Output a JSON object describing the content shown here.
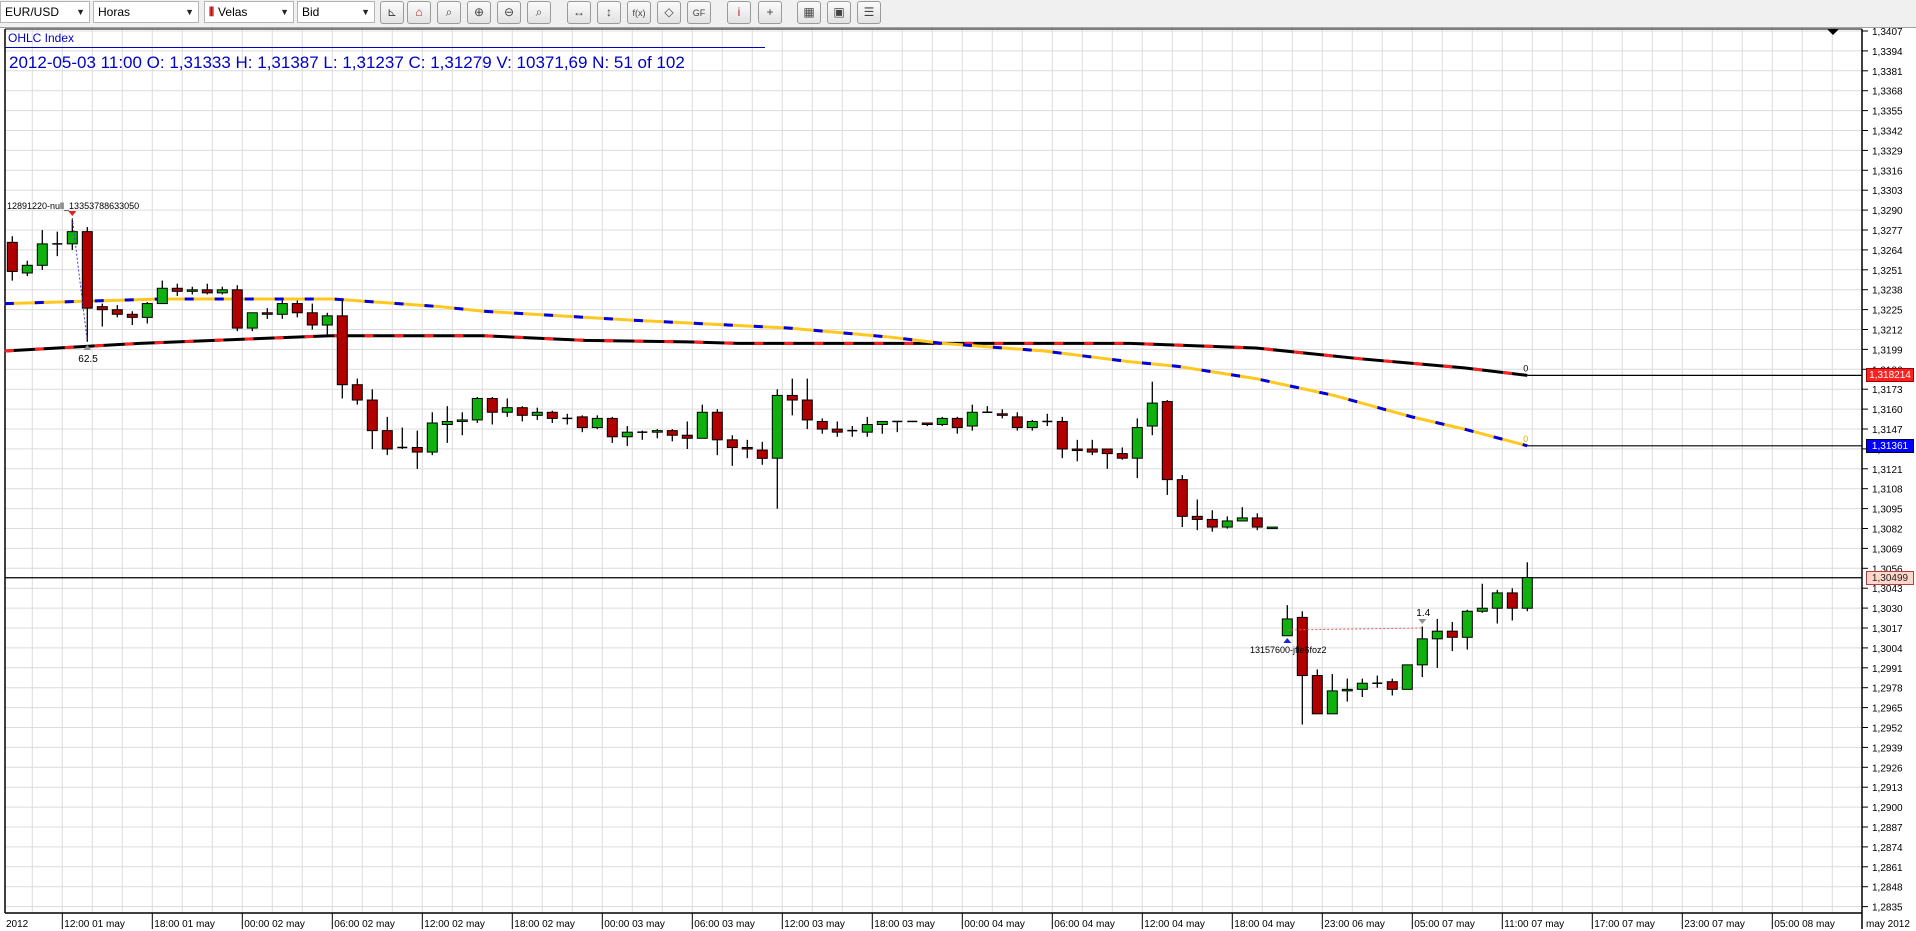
{
  "toolbar": {
    "combos": [
      {
        "value": "EUR/USD"
      },
      {
        "value": "Horas"
      },
      {
        "value": "Velas",
        "icon": "candlestick-icon",
        "glyph": "⫴"
      },
      {
        "value": "Bid"
      }
    ],
    "combo_arrow": "▼",
    "buttons": [
      {
        "icon": "axis-marker-icon",
        "glyph": "⊾"
      },
      {
        "icon": "lock-icon",
        "glyph": "⌂"
      },
      {
        "icon": "zoom-fit-icon",
        "glyph": "⌕"
      },
      {
        "icon": "zoom-in-icon",
        "glyph": "⊕"
      },
      {
        "icon": "zoom-out-icon",
        "glyph": "⊖"
      },
      {
        "icon": "zoom-select-icon",
        "glyph": "⌕"
      },
      {
        "icon": "fit-horizontal-icon",
        "glyph": "↔"
      },
      {
        "icon": "fit-vertical-icon",
        "glyph": "↕"
      },
      {
        "icon": "function-icon",
        "glyph": "f(x)"
      },
      {
        "icon": "shapes-icon",
        "glyph": "◇"
      },
      {
        "icon": "gf-icon",
        "glyph": "GF"
      },
      {
        "icon": "info-icon",
        "glyph": "i"
      },
      {
        "icon": "crosshair-icon",
        "glyph": "+"
      },
      {
        "icon": "color-palette-icon",
        "glyph": "▦"
      },
      {
        "icon": "save-image-icon",
        "glyph": "▣"
      },
      {
        "icon": "window-layout-icon",
        "glyph": "☰"
      }
    ]
  },
  "header": {
    "title": "OHLC Index",
    "ohlc_readout": "2012-05-03 11:00 O: 1,31333 H: 1,31387 L: 1,31237 C: 1,31279 V: 10371,69 N: 51 of 102"
  },
  "chart_data": {
    "type": "candlestick",
    "symbol": "EUR/USD",
    "timeframe": "Horas",
    "price_type": "Bid",
    "bar_count": 102,
    "ylim": [
      1.2835,
      1.3407
    ],
    "grid": true,
    "colors": {
      "up": "#10b010",
      "down": "#b00000",
      "ma_slow": [
        "#000000",
        "#ff2020"
      ],
      "ma_fast": [
        "#ffc820",
        "#0000e0"
      ]
    },
    "candles_ohlc": [
      [
        1.3269,
        1.3273,
        1.3244,
        1.325
      ],
      [
        1.3249,
        1.3257,
        1.3247,
        1.3254
      ],
      [
        1.3254,
        1.3277,
        1.3251,
        1.3268
      ],
      [
        1.3268,
        1.3276,
        1.326,
        1.3268
      ],
      [
        1.3268,
        1.3284,
        1.3264,
        1.3276
      ],
      [
        1.3276,
        1.3279,
        1.3204,
        1.3226
      ],
      [
        1.3227,
        1.3229,
        1.3214,
        1.3225
      ],
      [
        1.3225,
        1.3228,
        1.322,
        1.3222
      ],
      [
        1.3222,
        1.3224,
        1.3215,
        1.322
      ],
      [
        1.322,
        1.323,
        1.3216,
        1.3229
      ],
      [
        1.3229,
        1.3244,
        1.3229,
        1.3239
      ],
      [
        1.3239,
        1.3242,
        1.3234,
        1.3237
      ],
      [
        1.3237,
        1.324,
        1.3235,
        1.3238
      ],
      [
        1.3238,
        1.3242,
        1.3235,
        1.3236
      ],
      [
        1.3236,
        1.324,
        1.3235,
        1.3238
      ],
      [
        1.3238,
        1.3241,
        1.3211,
        1.3213
      ],
      [
        1.3213,
        1.3223,
        1.3211,
        1.3223
      ],
      [
        1.3223,
        1.3226,
        1.3219,
        1.3222
      ],
      [
        1.3222,
        1.3231,
        1.3219,
        1.3229
      ],
      [
        1.3229,
        1.3231,
        1.322,
        1.3223
      ],
      [
        1.3223,
        1.3229,
        1.3212,
        1.3215
      ],
      [
        1.3215,
        1.3223,
        1.3207,
        1.3221
      ],
      [
        1.3221,
        1.3231,
        1.3167,
        1.3176
      ],
      [
        1.3176,
        1.318,
        1.3163,
        1.3166
      ],
      [
        1.3166,
        1.3173,
        1.3134,
        1.3146
      ],
      [
        1.3146,
        1.3155,
        1.313,
        1.3134
      ],
      [
        1.3135,
        1.3148,
        1.3134,
        1.3135
      ],
      [
        1.3135,
        1.3146,
        1.3121,
        1.3132
      ],
      [
        1.3132,
        1.3158,
        1.313,
        1.3151
      ],
      [
        1.315,
        1.3162,
        1.3138,
        1.3152
      ],
      [
        1.3152,
        1.3158,
        1.3143,
        1.3153
      ],
      [
        1.3153,
        1.3168,
        1.3151,
        1.3167
      ],
      [
        1.3167,
        1.3168,
        1.315,
        1.3158
      ],
      [
        1.3158,
        1.3167,
        1.3155,
        1.3161
      ],
      [
        1.3161,
        1.3162,
        1.3152,
        1.3156
      ],
      [
        1.3156,
        1.3161,
        1.3153,
        1.3158
      ],
      [
        1.3158,
        1.3159,
        1.3151,
        1.3154
      ],
      [
        1.3154,
        1.3157,
        1.315,
        1.3154
      ],
      [
        1.3155,
        1.3156,
        1.3145,
        1.3148
      ],
      [
        1.3148,
        1.3156,
        1.3147,
        1.3154
      ],
      [
        1.3154,
        1.3155,
        1.3138,
        1.3142
      ],
      [
        1.3142,
        1.3149,
        1.3136,
        1.3145
      ],
      [
        1.3145,
        1.3146,
        1.314,
        1.3145
      ],
      [
        1.3145,
        1.3147,
        1.3141,
        1.3146
      ],
      [
        1.3146,
        1.3147,
        1.3139,
        1.3143
      ],
      [
        1.3143,
        1.3152,
        1.3134,
        1.3141
      ],
      [
        1.3141,
        1.3163,
        1.3141,
        1.3158
      ],
      [
        1.3158,
        1.316,
        1.313,
        1.314
      ],
      [
        1.314,
        1.3143,
        1.3123,
        1.3135
      ],
      [
        1.3135,
        1.314,
        1.3128,
        1.3134
      ],
      [
        1.31333,
        1.31387,
        1.31237,
        1.31279
      ],
      [
        1.3128,
        1.3173,
        1.3095,
        1.3169
      ],
      [
        1.3169,
        1.318,
        1.3156,
        1.3166
      ],
      [
        1.3166,
        1.318,
        1.3147,
        1.3153
      ],
      [
        1.3152,
        1.3154,
        1.3144,
        1.3147
      ],
      [
        1.3147,
        1.3152,
        1.3142,
        1.3145
      ],
      [
        1.3146,
        1.3149,
        1.3142,
        1.3146
      ],
      [
        1.3145,
        1.3155,
        1.3142,
        1.315
      ],
      [
        1.315,
        1.3152,
        1.3144,
        1.3152
      ],
      [
        1.3152,
        1.3152,
        1.3145,
        1.3152
      ],
      [
        1.3152,
        1.3152,
        1.3152,
        1.3152
      ],
      [
        1.3151,
        1.3151,
        1.3149,
        1.315
      ],
      [
        1.315,
        1.3155,
        1.3149,
        1.3154
      ],
      [
        1.3154,
        1.3155,
        1.3144,
        1.3148
      ],
      [
        1.3149,
        1.3163,
        1.3146,
        1.3158
      ],
      [
        1.3158,
        1.3162,
        1.3158,
        1.3158
      ],
      [
        1.3157,
        1.316,
        1.3154,
        1.3156
      ],
      [
        1.3155,
        1.3158,
        1.3146,
        1.3148
      ],
      [
        1.3148,
        1.3153,
        1.3146,
        1.3152
      ],
      [
        1.3152,
        1.3157,
        1.3149,
        1.3152
      ],
      [
        1.3152,
        1.3155,
        1.3128,
        1.3134
      ],
      [
        1.3134,
        1.314,
        1.3126,
        1.3133
      ],
      [
        1.3134,
        1.314,
        1.313,
        1.3132
      ],
      [
        1.3134,
        1.3134,
        1.3121,
        1.3131
      ],
      [
        1.3131,
        1.3135,
        1.3127,
        1.3128
      ],
      [
        1.3128,
        1.3154,
        1.3115,
        1.3148
      ],
      [
        1.3149,
        1.3178,
        1.3143,
        1.3164
      ],
      [
        1.3165,
        1.3166,
        1.3104,
        1.3114
      ],
      [
        1.3114,
        1.3117,
        1.3083,
        1.309
      ],
      [
        1.309,
        1.3101,
        1.3081,
        1.3088
      ],
      [
        1.3088,
        1.3094,
        1.308,
        1.3083
      ],
      [
        1.3083,
        1.309,
        1.3082,
        1.3087
      ],
      [
        1.3087,
        1.3096,
        1.3087,
        1.3089
      ],
      [
        1.3089,
        1.3092,
        1.3081,
        1.3083
      ],
      [
        1.3082,
        1.3083,
        1.3082,
        1.3083
      ],
      [
        1.3012,
        1.3032,
        1.3012,
        1.3023
      ],
      [
        1.3024,
        1.3028,
        1.2954,
        1.2986
      ],
      [
        1.2986,
        1.299,
        1.2961,
        1.2961
      ],
      [
        1.2961,
        1.2987,
        1.2961,
        1.2976
      ],
      [
        1.2976,
        1.2984,
        1.2969,
        1.2977
      ],
      [
        1.2977,
        1.2984,
        1.2972,
        1.2981
      ],
      [
        1.2981,
        1.2986,
        1.2978,
        1.2981
      ],
      [
        1.2982,
        1.2984,
        1.2973,
        1.2977
      ],
      [
        1.2977,
        1.2993,
        1.2977,
        1.2993
      ],
      [
        1.2993,
        1.3018,
        1.2985,
        1.301
      ],
      [
        1.301,
        1.3023,
        1.2991,
        1.3015
      ],
      [
        1.3015,
        1.3021,
        1.3002,
        1.3011
      ],
      [
        1.3011,
        1.3029,
        1.3003,
        1.3028
      ],
      [
        1.3028,
        1.3046,
        1.3027,
        1.303
      ],
      [
        1.303,
        1.3042,
        1.302,
        1.304
      ],
      [
        1.304,
        1.3043,
        1.3022,
        1.303
      ],
      [
        1.303,
        1.306,
        1.3028,
        1.305
      ]
    ],
    "moving_averages": [
      {
        "style": "black-red",
        "points": [
          [
            0.5,
            1.3198
          ],
          [
            9.5,
            1.3203
          ],
          [
            22.2,
            1.3208
          ],
          [
            32.4,
            1.3208
          ],
          [
            39.2,
            1.3205
          ],
          [
            46,
            1.3204
          ],
          [
            49.4,
            1.3203
          ],
          [
            75.5,
            1.3203
          ],
          [
            83.9,
            1.32
          ],
          [
            90.8,
            1.3193
          ],
          [
            97.8,
            1.3187
          ],
          [
            102,
            1.31821
          ]
        ],
        "end_label": "1,318214",
        "end_marker": "0"
      },
      {
        "style": "yellow-blue",
        "points": [
          [
            0.5,
            1.3229
          ],
          [
            10.9,
            1.3232
          ],
          [
            22.4,
            1.3232
          ],
          [
            29.5,
            1.3227
          ],
          [
            32.4,
            1.3224
          ],
          [
            42.6,
            1.3218
          ],
          [
            52.8,
            1.3213
          ],
          [
            59.6,
            1.3207
          ],
          [
            63,
            1.3203
          ],
          [
            69.8,
            1.3198
          ],
          [
            75.5,
            1.3191
          ],
          [
            78.7,
            1.3188
          ],
          [
            83.9,
            1.318
          ],
          [
            89.1,
            1.3169
          ],
          [
            94.3,
            1.3155
          ],
          [
            97.8,
            1.3147
          ],
          [
            102,
            1.31361
          ]
        ],
        "end_label": "1,31361",
        "end_marker": "0"
      }
    ],
    "horizontal_line": {
      "price": 1.30499,
      "label": "1,30499"
    },
    "y_tick_labels": [
      "1,3407",
      "1,3394",
      "1,3381",
      "1,3368",
      "1,3355",
      "1,3342",
      "1,3329",
      "1,3316",
      "1,3303",
      "1,3290",
      "1,3277",
      "1,3264",
      "1,3251",
      "1,3238",
      "1,3225",
      "1,3212",
      "1,3199",
      "1,3186",
      "1,3173",
      "1,3160",
      "1,3147",
      "1,3134",
      "1,3121",
      "1,3108",
      "1,3095",
      "1,3082",
      "1,3069",
      "1,3056",
      "1,3043",
      "1,3030",
      "1,3017",
      "1,3004",
      "1,2991",
      "1,2978",
      "1,2965",
      "1,2952",
      "1,2939",
      "1,2926",
      "1,2913",
      "1,2900",
      "1,2887",
      "1,2874",
      "1,2861",
      "1,2848",
      "1,2835"
    ],
    "x_start_label": "2012",
    "x_end_label": "may 2012",
    "x_tick_labels": [
      {
        "bar": 4,
        "label": "12:00 01 may"
      },
      {
        "bar": 10,
        "label": "18:00 01 may"
      },
      {
        "bar": 16,
        "label": "00:00 02 may"
      },
      {
        "bar": 22,
        "label": "06:00 02 may"
      },
      {
        "bar": 28,
        "label": "12:00 02 may"
      },
      {
        "bar": 34,
        "label": "18:00 02 may"
      },
      {
        "bar": 40,
        "label": "00:00 03 may"
      },
      {
        "bar": 46,
        "label": "06:00 03 may"
      },
      {
        "bar": 52,
        "label": "12:00 03 may"
      },
      {
        "bar": 58,
        "label": "18:00 03 may"
      },
      {
        "bar": 64,
        "label": "00:00 04 may"
      },
      {
        "bar": 70,
        "label": "06:00 04 may"
      },
      {
        "bar": 76,
        "label": "12:00 04 may"
      },
      {
        "bar": 82,
        "label": "18:00 04 may"
      },
      {
        "bar": 88,
        "label": "23:00 06 may"
      },
      {
        "bar": 94,
        "label": "05:00 07 may"
      },
      {
        "bar": 100,
        "label": "11:00 07 may"
      },
      {
        "bar": 106,
        "label": "17:00 07 may"
      },
      {
        "bar": 112,
        "label": "23:00 07 may"
      },
      {
        "bar": 118,
        "label": "05:00 08 may"
      }
    ],
    "annotations": [
      {
        "text": "12891220-null_13353788633050",
        "from_bar": 5,
        "to_bar": 6,
        "value_label": "62.5"
      },
      {
        "text": "13157600-jfle6foz2",
        "from_bar": 86,
        "to_bar": 95,
        "value_label": "1.4"
      }
    ]
  }
}
